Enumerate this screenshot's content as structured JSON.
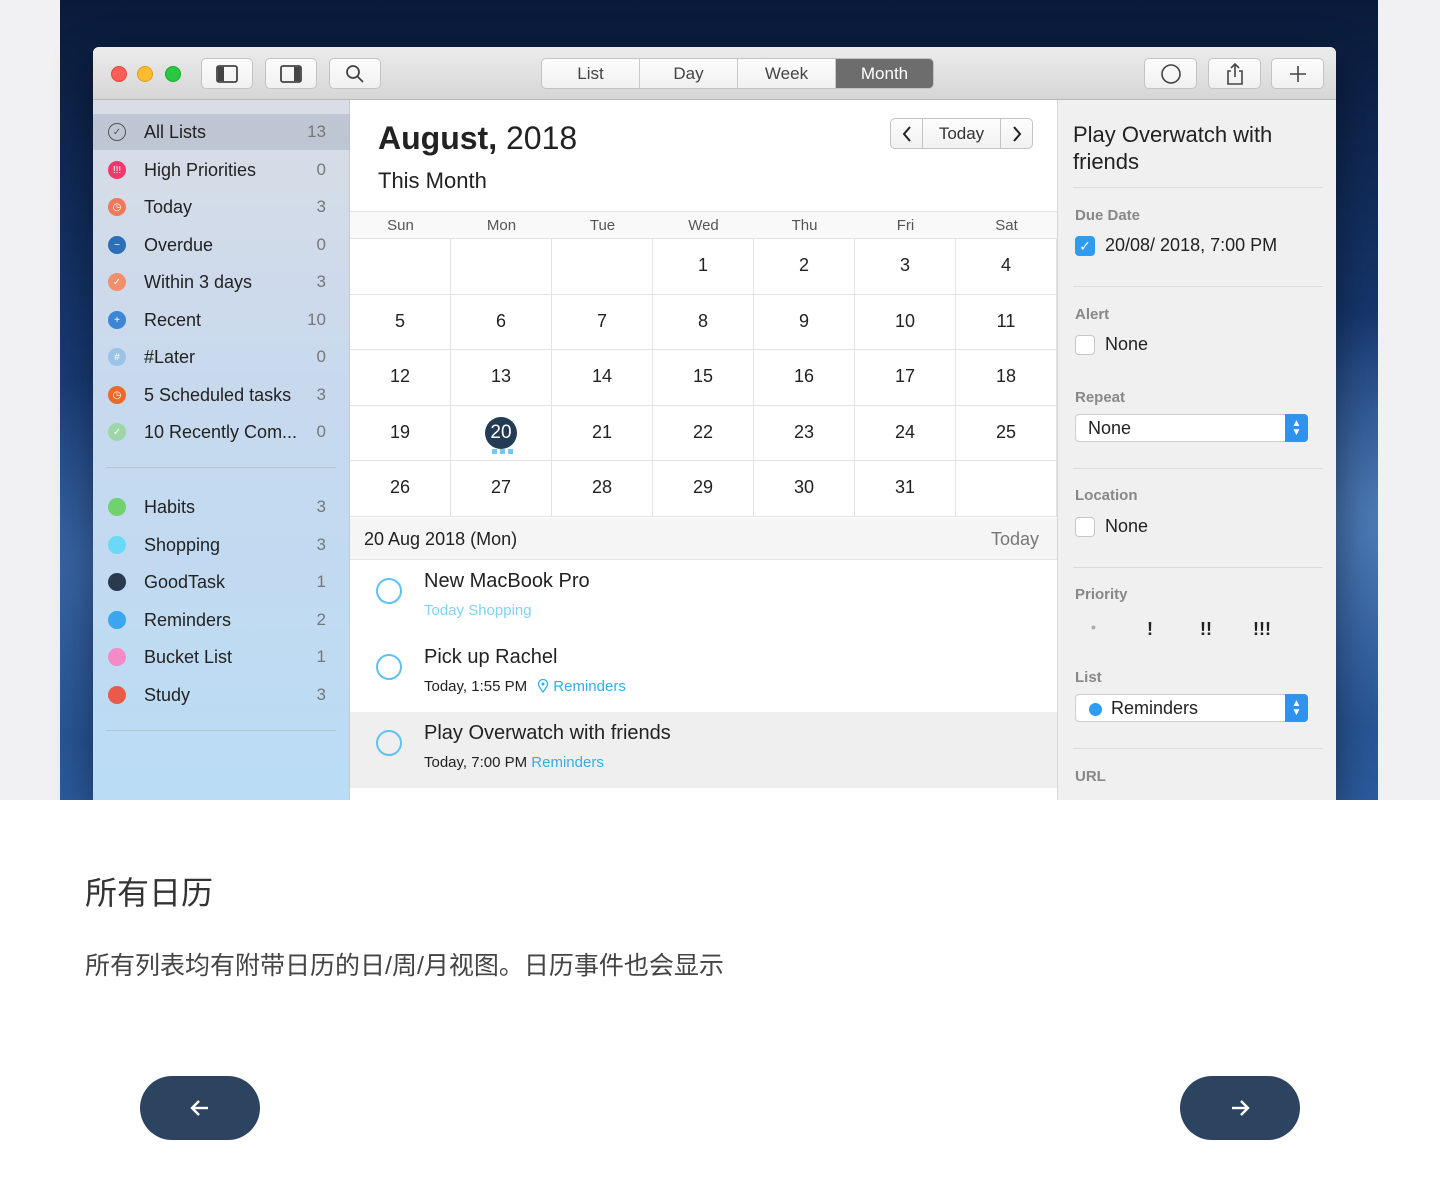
{
  "toolbar": {
    "views": [
      "List",
      "Day",
      "Week",
      "Month"
    ],
    "active_view": "Month",
    "icons": {
      "sidebar_left": "sidebar-left-icon",
      "sidebar_right": "sidebar-right-icon",
      "search": "search-icon",
      "circle": "circle-icon",
      "share": "share-icon",
      "add": "plus-icon"
    }
  },
  "sidebar": {
    "smart_lists": [
      {
        "label": "All Lists",
        "count": "13",
        "color": "#ffffff",
        "icon": "check-circle-icon"
      },
      {
        "label": "High Priorities",
        "count": "0",
        "color": "#f0386b",
        "icon": "priority-icon"
      },
      {
        "label": "Today",
        "count": "3",
        "color": "#ef7a5a",
        "icon": "clock-icon"
      },
      {
        "label": "Overdue",
        "count": "0",
        "color": "#2d6eb8",
        "icon": "overdue-icon"
      },
      {
        "label": "Within 3 days",
        "count": "3",
        "color": "#f28f6a",
        "icon": "check-icon"
      },
      {
        "label": "Recent",
        "count": "10",
        "color": "#3d86d6",
        "icon": "plus-icon"
      },
      {
        "label": "#Later",
        "count": "0",
        "color": "#9cc2e6",
        "icon": "hashtag-icon"
      },
      {
        "label": "5 Scheduled tasks",
        "count": "3",
        "color": "#ea6a2b",
        "icon": "clock-icon"
      },
      {
        "label": "10 Recently Com...",
        "count": "0",
        "color": "#9fd6a8",
        "icon": "check-icon"
      }
    ],
    "lists": [
      {
        "label": "Habits",
        "count": "3",
        "color": "#6fd26d"
      },
      {
        "label": "Shopping",
        "count": "3",
        "color": "#6ad8f7"
      },
      {
        "label": "GoodTask",
        "count": "1",
        "color": "#2a3a4e"
      },
      {
        "label": "Reminders",
        "count": "2",
        "color": "#3aa6ef"
      },
      {
        "label": "Bucket List",
        "count": "1",
        "color": "#f48bc7"
      },
      {
        "label": "Study",
        "count": "3",
        "color": "#e85b4a"
      }
    ]
  },
  "calendar": {
    "month": "August,",
    "year": "2018",
    "subtitle": "This Month",
    "today_button": "Today",
    "weekdays": [
      "Sun",
      "Mon",
      "Tue",
      "Wed",
      "Thu",
      "Fri",
      "Sat"
    ],
    "weeks": [
      [
        "",
        "",
        "",
        "1",
        "2",
        "3",
        "4"
      ],
      [
        "5",
        "6",
        "7",
        "8",
        "9",
        "10",
        "11"
      ],
      [
        "12",
        "13",
        "14",
        "15",
        "16",
        "17",
        "18"
      ],
      [
        "19",
        "20",
        "21",
        "22",
        "23",
        "24",
        "25"
      ],
      [
        "26",
        "27",
        "28",
        "29",
        "30",
        "31",
        ""
      ]
    ],
    "selected_day": "20"
  },
  "day_list": {
    "date_label": "20 Aug 2018 (Mon)",
    "right_label": "Today",
    "tasks": [
      {
        "title": "New MacBook Pro",
        "meta_time": "",
        "meta_list": "Today  Shopping",
        "selected": false
      },
      {
        "title": "Pick up Rachel",
        "meta_time": "Today, 1:55 PM",
        "meta_list": "Reminders",
        "selected": false
      },
      {
        "title": "Play Overwatch with friends",
        "meta_time": "Today, 7:00 PM",
        "meta_list": "Reminders",
        "selected": true
      }
    ]
  },
  "detail": {
    "title": "Play Overwatch with friends",
    "due_label": "Due Date",
    "due_value": "20/08/ 2018,   7:00 PM",
    "alert_label": "Alert",
    "alert_value": "None",
    "repeat_label": "Repeat",
    "repeat_value": "None",
    "location_label": "Location",
    "location_value": "None",
    "priority_label": "Priority",
    "priority_options": [
      "•",
      "!",
      "!!",
      "!!!"
    ],
    "list_label": "List",
    "list_value": "Reminders",
    "url_label": "URL"
  },
  "caption": {
    "title": "所有日历",
    "text": "所有列表均有附带日历的日/周/月视图。日历事件也会显示"
  },
  "nav": {
    "prev_icon": "arrow-left-icon",
    "next_icon": "arrow-right-icon"
  }
}
